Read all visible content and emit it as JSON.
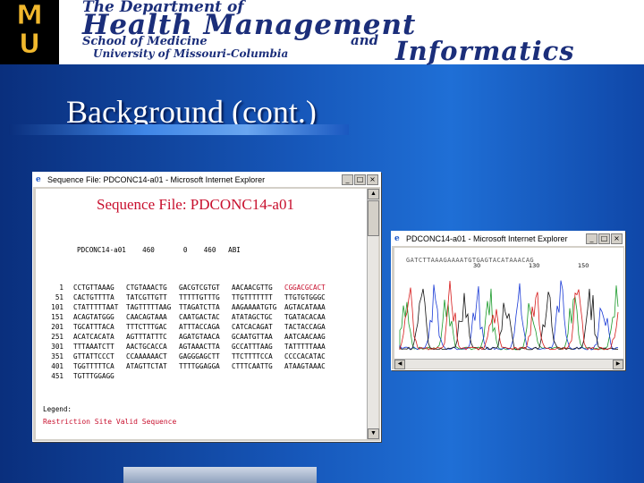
{
  "banner": {
    "logo_top": "M",
    "logo_bottom": "U",
    "line1": "The Department of",
    "line2": "Health Management",
    "line3": "School of Medicine",
    "line4": "and",
    "line5": "University of Missouri-Columbia",
    "line6": "Informatics"
  },
  "slide": {
    "title": "Background (cont.)"
  },
  "window1": {
    "title": "Sequence File: PDCONC14-a01 - Microsoft Internet Explorer",
    "heading": "Sequence File: PDCONC14-a01",
    "meta": "PDCONC14-a01    460       0    460   ABI",
    "rows": [
      {
        "num": "1",
        "c": [
          "CCTGTTAAAG",
          "CTGTAAACTG",
          "GACGTCGTGT",
          "AACAACGTTG",
          "CGGACGCACT"
        ]
      },
      {
        "num": "51",
        "c": [
          "CACTGTTTTA",
          "TATCGTTGTT",
          "TTTTTGTTTG",
          "TTGTTTTTTT",
          "TTGTGTGGGC"
        ]
      },
      {
        "num": "101",
        "c": [
          "CTATTTTTAAT",
          "TAGTTTTTAAG",
          "TTAGATCTTA",
          "AAGAAAATGTG",
          "AGTACATAAA"
        ]
      },
      {
        "num": "151",
        "c": [
          "ACAGTATGGG",
          "CAACAGTAAA",
          "CAATGACTAC",
          "ATATAGCTGC",
          "TGATACACAA"
        ]
      },
      {
        "num": "201",
        "c": [
          "TGCATTTACA",
          "TTTCTTTGAC",
          "ATTTACCAGA",
          "CATCACAGAT",
          "TACTACCAGA"
        ]
      },
      {
        "num": "251",
        "c": [
          "ACATCACATA",
          "AGTTTATTTC",
          "AGATGTAACA",
          "GCAATGTTAA",
          "AATCAACAAG"
        ]
      },
      {
        "num": "301",
        "c": [
          "TTTAAATCTT",
          "AACTGCACCA",
          "AGTAAACTTA",
          "GCCATTTAAG",
          "TATTTTTAAA"
        ]
      },
      {
        "num": "351",
        "c": [
          "GTTATTCCCT",
          "CCAAAAAACT",
          "GAGGGAGCTT",
          "TTCTTTTCCA",
          "CCCCACATAC"
        ]
      },
      {
        "num": "401",
        "c": [
          "TGGTTTTTCA",
          "ATAGTTCTAT",
          "TTTTGGAGGA",
          "CTTTCAATTG",
          "ATAAGTAAAC"
        ]
      },
      {
        "num": "451",
        "c": [
          "TGTTTGGAGG",
          "",
          "",
          "",
          ""
        ]
      }
    ],
    "legend_label": "Legend:",
    "legend_items": "Restriction Site Valid Sequence"
  },
  "window2": {
    "title": "PDCONC14-a01 - Microsoft Internet Explorer",
    "trace_bases": "GATCTTAAAGAAAATGTGAGTACATAAACAG",
    "ticks": [
      "30",
      "130",
      "150"
    ]
  },
  "colors": {
    "accent_red": "#c8102e",
    "background_blue": "#1656b8",
    "mizzou_gold": "#f1b82d"
  },
  "icons": [
    "ie-icon",
    "minimize-icon",
    "maximize-icon",
    "close-icon"
  ]
}
